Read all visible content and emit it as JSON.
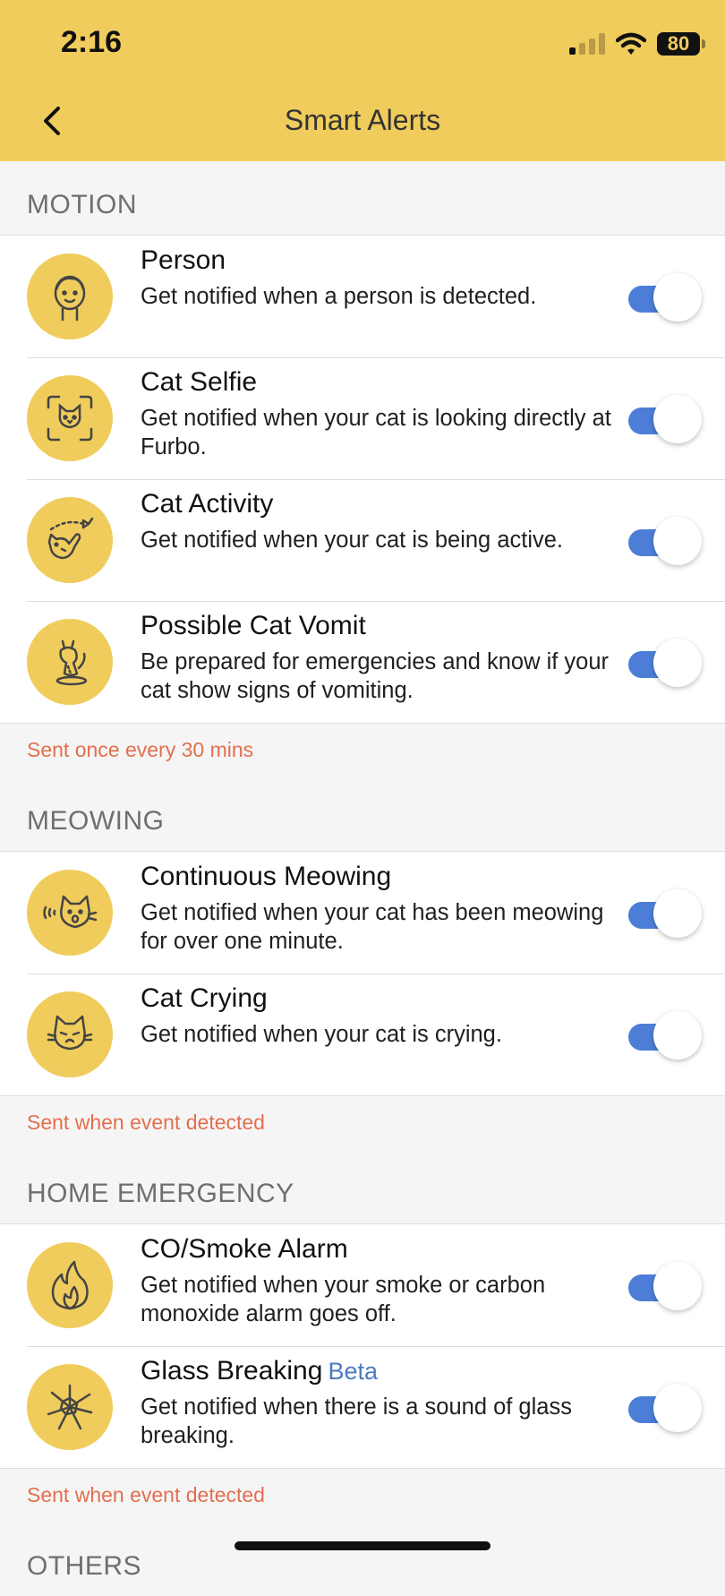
{
  "status": {
    "time": "2:16",
    "battery": "80"
  },
  "header": {
    "title": "Smart Alerts",
    "back_icon": "chevron-left-icon"
  },
  "sections": [
    {
      "title": "MOTION",
      "items": [
        {
          "title": "Person",
          "desc": "Get notified when a person is detected.",
          "icon": "person-icon",
          "on": true
        },
        {
          "title": "Cat Selfie",
          "desc": "Get notified when your cat is looking directly at Furbo.",
          "icon": "cat-selfie-icon",
          "on": true
        },
        {
          "title": "Cat Activity",
          "desc": "Get notified when your cat is being active.",
          "icon": "cat-activity-icon",
          "on": true
        },
        {
          "title": "Possible Cat Vomit",
          "desc": "Be prepared for emergencies and know if your cat show signs of vomiting.",
          "icon": "cat-vomit-icon",
          "on": true
        }
      ],
      "note": "Sent once every 30 mins"
    },
    {
      "title": "MEOWING",
      "items": [
        {
          "title": "Continuous Meowing",
          "desc": "Get notified when your cat has been meowing for over one minute.",
          "icon": "cat-meowing-icon",
          "on": true
        },
        {
          "title": "Cat Crying",
          "desc": "Get notified when your cat is crying.",
          "icon": "cat-crying-icon",
          "on": true
        }
      ],
      "note": "Sent when event detected"
    },
    {
      "title": "HOME EMERGENCY",
      "items": [
        {
          "title": "CO/Smoke Alarm",
          "desc": "Get notified when your smoke or carbon monoxide alarm goes off.",
          "icon": "flame-icon",
          "on": true
        },
        {
          "title": "Glass Breaking",
          "badge": "Beta",
          "desc": "Get notified when there is a sound of glass breaking.",
          "icon": "glass-breaking-icon",
          "on": true
        }
      ],
      "note": "Sent when event detected"
    },
    {
      "title": "OTHERS",
      "items": []
    }
  ],
  "colors": {
    "header_bg": "#f0cc5c",
    "toggle_on": "#4d7ed7",
    "note": "#e26f4f",
    "beta": "#4a7cbf"
  }
}
